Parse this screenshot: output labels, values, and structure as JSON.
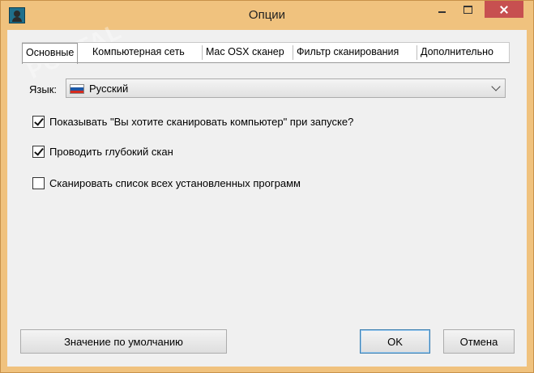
{
  "window": {
    "title": "Опции",
    "icon": "app-icon",
    "colors": {
      "frame": "#f0c27e",
      "close": "#c75050",
      "client": "#f0f0f0"
    }
  },
  "tabs": [
    {
      "label": "Основные",
      "active": true
    },
    {
      "label": "Компьютерная сеть",
      "active": false
    },
    {
      "label": "Mac OSX сканер",
      "active": false
    },
    {
      "label": "Фильтр сканирования",
      "active": false
    },
    {
      "label": "Дополнительно",
      "active": false
    }
  ],
  "language": {
    "label": "Язык:",
    "selected": "Русский",
    "flag_icon": "russia-flag-icon",
    "flag_colors": [
      "#ffffff",
      "#1c57a5",
      "#d52b1e"
    ]
  },
  "options": [
    {
      "label": "Показывать \"Вы хотите сканировать компьютер\" при запуске?",
      "checked": true
    },
    {
      "label": "Проводить глубокий скан",
      "checked": true
    },
    {
      "label": "Сканировать список всех установленных программ",
      "checked": false
    }
  ],
  "buttons": {
    "defaults": "Значение по умолчанию",
    "ok": "OK",
    "cancel": "Отмена"
  },
  "watermark": "PORTAL"
}
